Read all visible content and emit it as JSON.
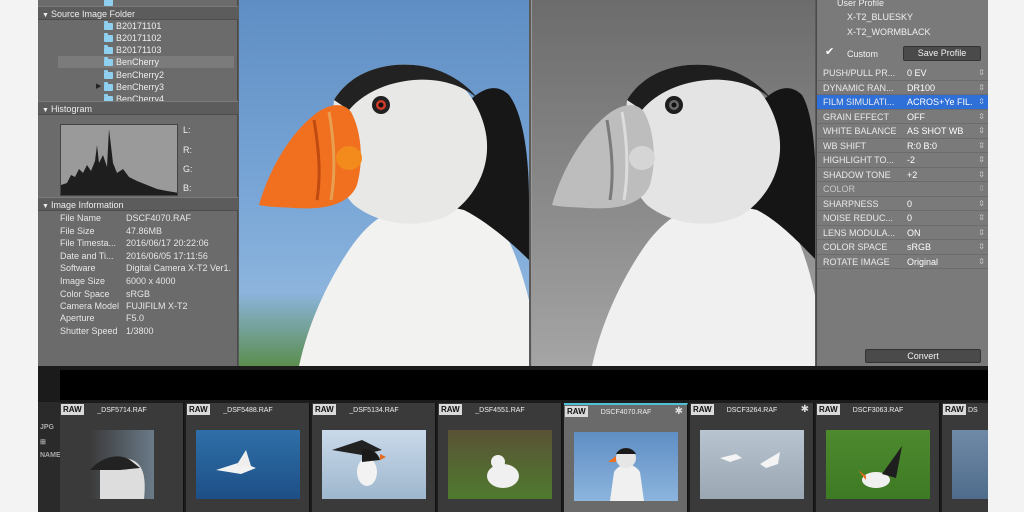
{
  "left_panel": {
    "folder_section": {
      "title": "Source Image Folder"
    },
    "folders": [
      {
        "label": "B20171101"
      },
      {
        "label": "B20171102"
      },
      {
        "label": "B20171103"
      },
      {
        "label": "BenCherry"
      },
      {
        "label": "BenCherry2"
      },
      {
        "label": "BenCherry3"
      },
      {
        "label": "BenCherry4"
      }
    ],
    "histogram_section": {
      "title": "Histogram",
      "labels": [
        "L:",
        "R:",
        "G:",
        "B:"
      ]
    },
    "info_section": {
      "title": "Image Information"
    },
    "info": [
      {
        "key": "File Name",
        "value": "DSCF4070.RAF"
      },
      {
        "key": "File Size",
        "value": "47.86MB"
      },
      {
        "key": "File Timesta...",
        "value": "2016/06/17 20:22:06"
      },
      {
        "key": "Date and Ti...",
        "value": "2016/06/05 17:11:56"
      },
      {
        "key": "Software",
        "value": "Digital Camera X-T2 Ver1."
      },
      {
        "key": "Image Size",
        "value": "6000 x 4000"
      },
      {
        "key": "Color Space",
        "value": "sRGB"
      },
      {
        "key": "Camera Model",
        "value": "FUJIFILM X-T2"
      },
      {
        "key": "Aperture",
        "value": "F5.0"
      },
      {
        "key": "Shutter Speed",
        "value": "1/3800"
      }
    ]
  },
  "right_panel": {
    "user_profile_label": "User Profile",
    "profiles": [
      "X-T2_BLUESKY",
      "X-T2_WORMBLACK"
    ],
    "custom_label": "Custom",
    "save_profile_label": "Save Profile",
    "params": [
      {
        "name": "PUSH/PULL PR...",
        "value": "0 EV"
      },
      {
        "name": "DYNAMIC RAN...",
        "value": "DR100"
      },
      {
        "name": "FILM SIMULATI...",
        "value": "ACROS+Ye FIL...",
        "active": true
      },
      {
        "name": "GRAIN EFFECT",
        "value": "OFF"
      },
      {
        "name": "WHITE BALANCE",
        "value": "AS SHOT WB"
      },
      {
        "name": "WB SHIFT",
        "value": "R:0 B:0"
      },
      {
        "name": "HIGHLIGHT TO...",
        "value": "-2"
      },
      {
        "name": "SHADOW TONE",
        "value": "+2"
      },
      {
        "name": "COLOR",
        "value": ""
      },
      {
        "name": "SHARPNESS",
        "value": "0"
      },
      {
        "name": "NOISE REDUC...",
        "value": "0"
      },
      {
        "name": "LENS MODULA...",
        "value": "ON"
      },
      {
        "name": "COLOR SPACE",
        "value": "sRGB"
      },
      {
        "name": "ROTATE IMAGE",
        "value": "Original"
      }
    ],
    "convert_label": "Convert"
  },
  "filmstrip": {
    "side_labels": [
      "JPG",
      "NAME"
    ],
    "thumbs": [
      {
        "name": "_DSF5714.RAF",
        "badge": "RAW",
        "starred": false
      },
      {
        "name": "_DSF5488.RAF",
        "badge": "RAW",
        "starred": false
      },
      {
        "name": "_DSF5134.RAF",
        "badge": "RAW",
        "starred": false
      },
      {
        "name": "_DSF4551.RAF",
        "badge": "RAW",
        "starred": false
      },
      {
        "name": "DSCF4070.RAF",
        "badge": "RAW",
        "starred": true,
        "selected": true
      },
      {
        "name": "DSCF3264.RAF",
        "badge": "RAW",
        "starred": true
      },
      {
        "name": "DSCF3063.RAF",
        "badge": "RAW",
        "starred": false
      },
      {
        "name": "DS",
        "badge": "RAW",
        "starred": false
      }
    ],
    "star_glyph": "✱"
  },
  "colors": {
    "accent": "#2e6fd8",
    "selection_bar": "#50c0d8",
    "puffin_beak": "#f07020"
  }
}
